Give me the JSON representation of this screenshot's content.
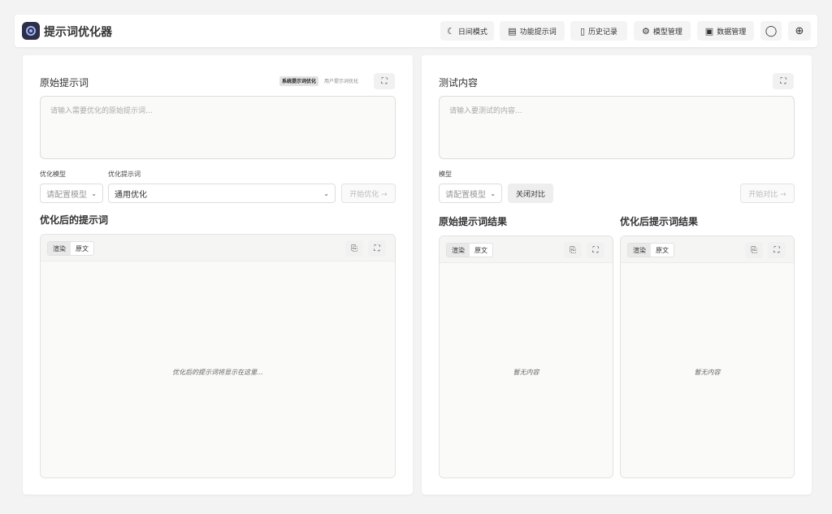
{
  "header": {
    "title": "提示词优化器",
    "nav": {
      "theme": {
        "label": "日间模式",
        "icon": "moon-icon"
      },
      "templates": {
        "label": "功能提示词",
        "icon": "note-icon"
      },
      "history": {
        "label": "历史记录",
        "icon": "scroll-icon"
      },
      "models": {
        "label": "模型管理",
        "icon": "gear-icon"
      },
      "data": {
        "label": "数据管理",
        "icon": "save-icon"
      },
      "github": {
        "icon": "github-icon"
      },
      "language": {
        "icon": "globe-icon"
      }
    }
  },
  "left": {
    "title": "原始提示词",
    "mode_tabs": [
      "系统提示词优化",
      "用户提示词优化"
    ],
    "active_mode": "系统提示词优化",
    "input_placeholder": "请输入需要优化的原始提示词...",
    "model_label": "优化模型",
    "template_label": "优化提示词",
    "model_placeholder": "请配置模型",
    "template_value": "通用优化",
    "optimize_button": "开始优化 →",
    "result_title": "优化后的提示词",
    "tabs": [
      "渲染",
      "原文"
    ],
    "empty_text": "优化后的提示词将显示在这里..."
  },
  "right": {
    "title": "测试内容",
    "input_placeholder": "请输入要测试的内容...",
    "model_label": "模型",
    "model_placeholder": "请配置模型",
    "compare_toggle": "关闭对比",
    "compare_button": "开始对比 →",
    "original_result_title": "原始提示词结果",
    "optimized_result_title": "优化后提示词结果",
    "tabs": [
      "渲染",
      "原文"
    ],
    "empty_text": "暂无内容"
  }
}
